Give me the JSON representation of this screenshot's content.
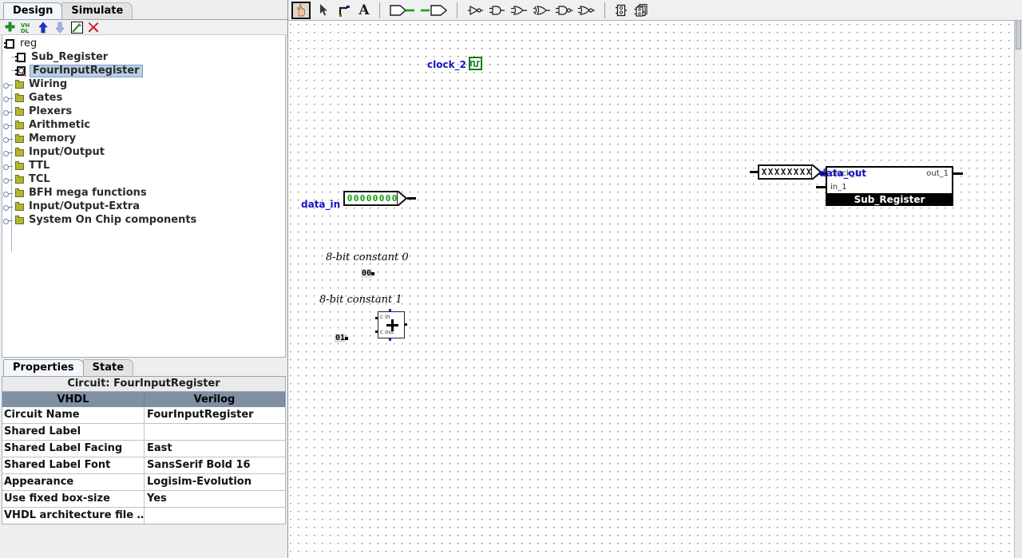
{
  "left_panel": {
    "tabs": [
      {
        "label": "Design",
        "selected": true
      },
      {
        "label": "Simulate",
        "selected": false
      }
    ],
    "toolbar": [
      {
        "name": "add-circuit-icon",
        "title": "Add Circuit"
      },
      {
        "name": "add-vhdl-icon",
        "title": "Add VHDL"
      },
      {
        "name": "move-up-icon",
        "title": "Move Up"
      },
      {
        "name": "move-down-icon",
        "title": "Move Down"
      },
      {
        "name": "edit-icon",
        "title": "Edit"
      },
      {
        "name": "delete-icon",
        "title": "Delete"
      }
    ],
    "tree": {
      "root": "reg",
      "items": [
        {
          "label": "Sub_Register",
          "kind": "circuit",
          "selected": false,
          "indent": 1
        },
        {
          "label": "FourInputRegister",
          "kind": "circuit-current",
          "selected": true,
          "indent": 1
        },
        {
          "label": "Wiring",
          "kind": "folder",
          "selected": false,
          "indent": 0
        },
        {
          "label": "Gates",
          "kind": "folder",
          "selected": false,
          "indent": 0
        },
        {
          "label": "Plexers",
          "kind": "folder",
          "selected": false,
          "indent": 0
        },
        {
          "label": "Arithmetic",
          "kind": "folder",
          "selected": false,
          "indent": 0
        },
        {
          "label": "Memory",
          "kind": "folder",
          "selected": false,
          "indent": 0
        },
        {
          "label": "Input/Output",
          "kind": "folder",
          "selected": false,
          "indent": 0
        },
        {
          "label": "TTL",
          "kind": "folder",
          "selected": false,
          "indent": 0
        },
        {
          "label": "TCL",
          "kind": "folder",
          "selected": false,
          "indent": 0
        },
        {
          "label": "BFH mega functions",
          "kind": "folder",
          "selected": false,
          "indent": 0
        },
        {
          "label": "Input/Output-Extra",
          "kind": "folder",
          "selected": false,
          "indent": 0
        },
        {
          "label": "System On Chip components",
          "kind": "folder",
          "selected": false,
          "indent": 0
        }
      ]
    }
  },
  "properties": {
    "tabs": [
      {
        "label": "Properties",
        "selected": true
      },
      {
        "label": "State",
        "selected": false
      }
    ],
    "title": "Circuit: FourInputRegister",
    "columns": [
      "VHDL",
      "Verilog"
    ],
    "rows": [
      {
        "key": "Circuit Name",
        "value": "FourInputRegister"
      },
      {
        "key": "Shared Label",
        "value": ""
      },
      {
        "key": "Shared Label Facing",
        "value": "East"
      },
      {
        "key": "Shared Label Font",
        "value": "SansSerif Bold 16"
      },
      {
        "key": "Appearance",
        "value": "Logisim-Evolution"
      },
      {
        "key": "Use fixed box-size",
        "value": "Yes"
      },
      {
        "key": "VHDL architecture file …",
        "value": ""
      }
    ]
  },
  "canvas_toolbar": [
    {
      "name": "poke-tool-icon",
      "selected": true
    },
    {
      "name": "select-tool-icon",
      "selected": false
    },
    {
      "name": "wiring-tool-icon",
      "selected": false
    },
    {
      "name": "text-tool-icon",
      "selected": false
    },
    {
      "name": "sep-1",
      "selected": false
    },
    {
      "name": "pin-input-icon",
      "selected": false
    },
    {
      "name": "pin-output-icon",
      "selected": false
    },
    {
      "name": "sep-2",
      "selected": false
    },
    {
      "name": "not-gate-icon",
      "selected": false
    },
    {
      "name": "and-gate-icon",
      "selected": false
    },
    {
      "name": "or-gate-icon",
      "selected": false
    },
    {
      "name": "xor-gate-icon",
      "selected": false
    },
    {
      "name": "nand-gate-icon",
      "selected": false
    },
    {
      "name": "nor-gate-icon",
      "selected": false
    },
    {
      "name": "sep-3",
      "selected": false
    },
    {
      "name": "add-circuit-icon",
      "selected": false
    },
    {
      "name": "duplicate-circuit-icon",
      "selected": false
    }
  ],
  "canvas": {
    "clock": {
      "label": "clock_2"
    },
    "data_in": {
      "label": "data_in",
      "bits": "00000000",
      "bit_state": "0"
    },
    "data_out": {
      "label": "data_out",
      "bits": "XXXXXXXX",
      "bit_state": "X"
    },
    "sub_register": {
      "title": "Sub_Register",
      "inputs": [
        "clock_1",
        "in_1"
      ],
      "outputs": [
        "out_1"
      ]
    },
    "annotations": [
      {
        "text": "8-bit constant 0"
      },
      {
        "text": "8-bit constant 1"
      }
    ],
    "constants": [
      {
        "value": "00"
      },
      {
        "value": "01"
      }
    ],
    "adder": {
      "carry_in": "c in",
      "carry_out": "c out",
      "symbol": "+"
    }
  }
}
